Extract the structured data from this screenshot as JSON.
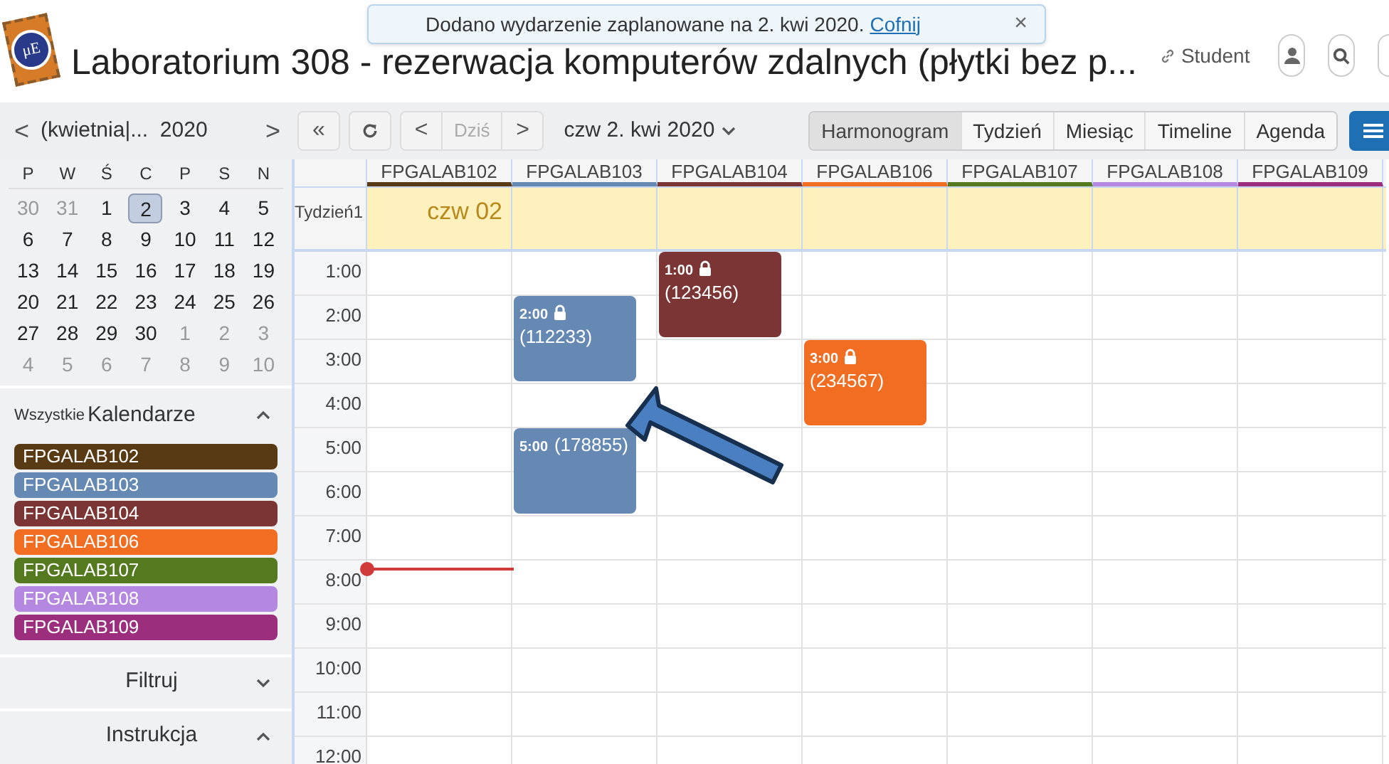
{
  "header": {
    "logo_text": "μE",
    "title": "Laboratorium 308 - rezerwacja komputerów zdalnych (płytki bez p...",
    "user_link": "Student"
  },
  "toast": {
    "message": "Dodano wydarzenie zaplanowane na 2. kwi 2020.",
    "link": "Cofnij",
    "close": "×"
  },
  "toolbar": {
    "month_prev": "<",
    "month_label": "(kwietnia|...  2020",
    "month_next": ">",
    "first": "«",
    "prev": "<",
    "today": {
      "label": "Dziś",
      "disabled": true
    },
    "next": ">",
    "date_label": "czw 2. kwi 2020",
    "views": [
      {
        "label": "Harmonogram",
        "selected": true
      },
      {
        "label": "Tydzień",
        "selected": false
      },
      {
        "label": "Miesiąc",
        "selected": false
      },
      {
        "label": "Timeline",
        "selected": false
      },
      {
        "label": "Agenda",
        "selected": false
      }
    ]
  },
  "mini_calendar": {
    "weekdays": [
      "P",
      "W",
      "Ś",
      "C",
      "P",
      "S",
      "N"
    ],
    "weeks": [
      [
        {
          "day": "30",
          "other_month": true,
          "selected": false
        },
        {
          "day": "31",
          "other_month": true,
          "selected": false
        },
        {
          "day": "1",
          "other_month": false,
          "selected": false
        },
        {
          "day": "2",
          "other_month": false,
          "selected": true
        },
        {
          "day": "3",
          "other_month": false,
          "selected": false
        },
        {
          "day": "4",
          "other_month": false,
          "selected": false
        },
        {
          "day": "5",
          "other_month": false,
          "selected": false
        }
      ],
      [
        {
          "day": "6",
          "other_month": false,
          "selected": false
        },
        {
          "day": "7",
          "other_month": false,
          "selected": false
        },
        {
          "day": "8",
          "other_month": false,
          "selected": false
        },
        {
          "day": "9",
          "other_month": false,
          "selected": false
        },
        {
          "day": "10",
          "other_month": false,
          "selected": false
        },
        {
          "day": "11",
          "other_month": false,
          "selected": false
        },
        {
          "day": "12",
          "other_month": false,
          "selected": false
        }
      ],
      [
        {
          "day": "13",
          "other_month": false,
          "selected": false
        },
        {
          "day": "14",
          "other_month": false,
          "selected": false
        },
        {
          "day": "15",
          "other_month": false,
          "selected": false
        },
        {
          "day": "16",
          "other_month": false,
          "selected": false
        },
        {
          "day": "17",
          "other_month": false,
          "selected": false
        },
        {
          "day": "18",
          "other_month": false,
          "selected": false
        },
        {
          "day": "19",
          "other_month": false,
          "selected": false
        }
      ],
      [
        {
          "day": "20",
          "other_month": false,
          "selected": false
        },
        {
          "day": "21",
          "other_month": false,
          "selected": false
        },
        {
          "day": "22",
          "other_month": false,
          "selected": false
        },
        {
          "day": "23",
          "other_month": false,
          "selected": false
        },
        {
          "day": "24",
          "other_month": false,
          "selected": false
        },
        {
          "day": "25",
          "other_month": false,
          "selected": false
        },
        {
          "day": "26",
          "other_month": false,
          "selected": false
        }
      ],
      [
        {
          "day": "27",
          "other_month": false,
          "selected": false
        },
        {
          "day": "28",
          "other_month": false,
          "selected": false
        },
        {
          "day": "29",
          "other_month": false,
          "selected": false
        },
        {
          "day": "30",
          "other_month": false,
          "selected": false
        },
        {
          "day": "1",
          "other_month": true,
          "selected": false
        },
        {
          "day": "2",
          "other_month": true,
          "selected": false
        },
        {
          "day": "3",
          "other_month": true,
          "selected": false
        }
      ],
      [
        {
          "day": "4",
          "other_month": true,
          "selected": false
        },
        {
          "day": "5",
          "other_month": true,
          "selected": false
        },
        {
          "day": "6",
          "other_month": true,
          "selected": false
        },
        {
          "day": "7",
          "other_month": true,
          "selected": false
        },
        {
          "day": "8",
          "other_month": true,
          "selected": false
        },
        {
          "day": "9",
          "other_month": true,
          "selected": false
        },
        {
          "day": "10",
          "other_month": true,
          "selected": false
        }
      ]
    ]
  },
  "calendars_section": {
    "all_label": "Wszystkie",
    "title": "Kalendarze",
    "expanded": true
  },
  "calendars": [
    {
      "name": "FPGALAB102",
      "color": "#583a15"
    },
    {
      "name": "FPGALAB103",
      "color": "#6589b3"
    },
    {
      "name": "FPGALAB104",
      "color": "#7b3535"
    },
    {
      "name": "FPGALAB106",
      "color": "#f06d22"
    },
    {
      "name": "FPGALAB107",
      "color": "#54791f"
    },
    {
      "name": "FPGALAB108",
      "color": "#b487e0"
    },
    {
      "name": "FPGALAB109",
      "color": "#9c2e7e"
    }
  ],
  "sections": [
    {
      "title": "Filtruj",
      "expanded": false
    },
    {
      "title": "Instrukcja",
      "expanded": true
    }
  ],
  "schedule": {
    "week_label": "Tydzień1",
    "day_label": "czw 02",
    "columns": [
      {
        "name": "FPGALAB102"
      },
      {
        "name": "FPGALAB103",
        "events": [
          {
            "time": "2:00",
            "label": "(112233)",
            "locked": true
          },
          {
            "time": "5:00",
            "label": "(178855)",
            "locked": false
          }
        ]
      },
      {
        "name": "FPGALAB104",
        "events": [
          {
            "time": "1:00",
            "label": "(123456)",
            "locked": true
          }
        ]
      },
      {
        "name": "FPGALAB106",
        "events": [
          {
            "time": "3:00",
            "label": "(234567)",
            "locked": true
          }
        ]
      },
      {
        "name": "FPGALAB107"
      },
      {
        "name": "FPGALAB108"
      },
      {
        "name": "FPGALAB109"
      }
    ],
    "hours": [
      "1:00",
      "2:00",
      "3:00",
      "4:00",
      "5:00",
      "6:00",
      "7:00",
      "8:00",
      "9:00",
      "10:00",
      "11:00",
      "12:00"
    ]
  }
}
